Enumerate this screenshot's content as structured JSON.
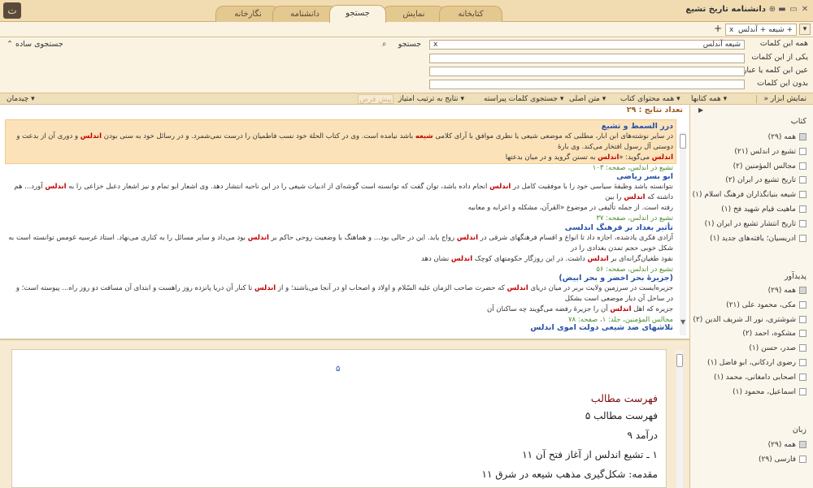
{
  "app": {
    "title": "دانشنامه تاریخ تشیع",
    "logo_glyph": "ت"
  },
  "main_tabs": [
    "نگارخانه",
    "دانشنامه",
    "جستجو",
    "نمایش",
    "کتابخانه"
  ],
  "active_tab": "جستجو",
  "window": {
    "min": "▬",
    "restore": "▭",
    "close": "✕",
    "pin": "⊕"
  },
  "doc_tab": {
    "label": "+ شیعه + آندلس",
    "close": "x",
    "add": "+",
    "menu": "▾"
  },
  "search": {
    "all_words_label": "همه این کلمات",
    "all_words_value": "شیعه آندلس",
    "clear": "x",
    "search_button": "جستجو",
    "one_word_label": "یکی از این کلمات",
    "exact_label": "عین این کلمه یا عبارت",
    "without_label": "بدون این کلمات",
    "simple_search": "جستجوی ساده",
    "collapse": "«"
  },
  "options_bar": {
    "show_tools": "نمایش ابزار",
    "all_books": "همه کتابها",
    "all_content": "همه محتوای کتاب",
    "main_text": "متن اصلی",
    "frequent_words": "جستجوی کلمات پیراسته",
    "sort_by_score": "نتایج به ترتیب امتیاز",
    "preview": "پیش فرض",
    "layout": "چیدمان"
  },
  "results": {
    "count_label": "تعداد نتایج : ۲۹",
    "items": [
      {
        "title": "درر السمط و تشیع",
        "l1a": "در سایر نوشته‌های ابن ابار، مطلبی که موضعی شیعی یا نظری موافق با آرای کلامی ",
        "h1": "شیعه",
        "l1b": " باشد نیامده است. وی در کتاب الحلة خود نسب فاطمیان را درست نمی‌شمرد. و در رسائل خود به سنی بودن ",
        "h2": "اندلس",
        "l1c": " و دوری آن از بدعت و دوستی آل رسول افتخار می‌کند. وی بارهٔ",
        "l2a": "",
        "h3": "اندلس",
        "l2b": " می‌گوید: «",
        "h4": "اندلس",
        "l2c": " به تسنن گروید و در میان بدعتها",
        "source": "تشیع در اندلس، صفحه: ۱۰۳"
      },
      {
        "title": "ابو بسر ریاضی",
        "l1a": "نتوانسته باشد وظیفهٔ سیاسی خود را با موفقیت کامل در ",
        "h1": "اندلس",
        "l1b": " انجام داده باشد، توان گفت که توانسته است گوشه‌ای از ادبیات شیعی را در این ناحیه انتشار دهد. وی اشعار ابو تمام و نیز اشعار دعبل خزاعی را به ",
        "h2": "اندلس",
        "l1c": " آورد... هم داشته که ",
        "h2b": "اندلس",
        "l1d": " را بین",
        "l2": "رفته است. از جمله تألیفی در موضوع «القرآن، مشکله و اعرابه و معانیه",
        "source": "تشیع در اندلس، صفحه: ۳۷"
      },
      {
        "title": "تأثیر بغداد بر فرهنگ اندلسی",
        "l1a": "آزادی فکری یادشده، اجازه داد تا انواع و اقسام فرهنگهای شرقی در ",
        "h1": "اندلس",
        "l1b": " رواج یابد. این در حالی بود... و هماهنگ با وضعیت روحی حاکم بر ",
        "h2": "اندلس",
        "l1c": " بود می‌داد و سایر مسائل را به کناری می‌نهاد. استاد غرسیه غومس توانسته است به شکل خوبی حجم تمدن بغدادی را در",
        "l2a": "نفوذ طغیان‌گرانه‌ای بر ",
        "h3": "اندلس",
        "l2b": " داشت. در این روزگار حکومتهای کوچک ",
        "h4": "اندلس",
        "l2c": " نشان دهد",
        "source": "تشیع در اندلس، صفحه: ۵۶"
      },
      {
        "title": "(جزیرهٔ بحر اخضر و بحر ابیض)",
        "l1a": "جزیره‌ایست در سرزمین ولایت بربر در میان دریای ",
        "h1": "اندلس",
        "l1b": " که حضرت صاحب الزمان علیه السّلام و اولاد و اصحاب او در آنجا می‌باشند؛ و از ",
        "h2": "اندلس",
        "l1c": " تا کنار آن دریا پانزده روز راهست و ابتدای آن مسافت دو روز راه... پیوسته است؛ و در ساحل آن دیار موضعی است بشکل",
        "l2a": "جزیره که اهل ",
        "h3": "اندلس",
        "l2b": " آن را جزیرهٔ رفضه می‌گویند چه ساکنان آن",
        "source": "مجالس المؤمنین، جلد: ۱، صفحه: ۷۸"
      },
      {
        "title": "تلاشهای ضد شیعی دولت اموی اندلس"
      }
    ]
  },
  "document": {
    "page_number": "۵",
    "heading": "فهرست مطالب",
    "lines": [
      "فهرست مطالب ۵",
      "درآمد ۹",
      "۱ ـ تشیع اندلس از آغاز فتح آن ۱۱",
      "مقدمه: شکل‌گیری مذهب شیعه در شرق ۱۱"
    ]
  },
  "facets": {
    "books_title": "کتاب",
    "books": [
      "همه (۲۹)",
      "تشیع در اندلس (۲۱)",
      "مجالس المؤمنین (۲)",
      "تاریخ تشیع در ایران (۲)",
      "شیعه بنیانگذاران فرهنگ اسلام (۱)",
      "ماهیت قیام شهید فخ (۱)",
      "تاریخ انتشار تشیع در ایران (۱)",
      "ادریسیان؛ یافته‌های جدید (۱)"
    ],
    "authors_title": "پدیدآور",
    "authors": [
      "همه (۲۹)",
      "مکی، محمود علی (۲۱)",
      "شوشتری، نور الـ شریف الدین (۲)",
      "مشکوه، احمد (۲)",
      "صدر، حسن (۱)",
      "رضوی اردکانی، ابو فاضل (۱)",
      "اصحابی دامغانی، محمد (۱)",
      "اسماعیل، محمود (۱)"
    ],
    "language_title": "زبان",
    "languages": [
      "همه (۲۹)",
      "فارسی (۲۹)"
    ]
  },
  "colors": {
    "accent": "#f1dcb1",
    "highlight": "#c00000",
    "title_blue": "#2750a8",
    "source_green": "#4d8a2f"
  }
}
